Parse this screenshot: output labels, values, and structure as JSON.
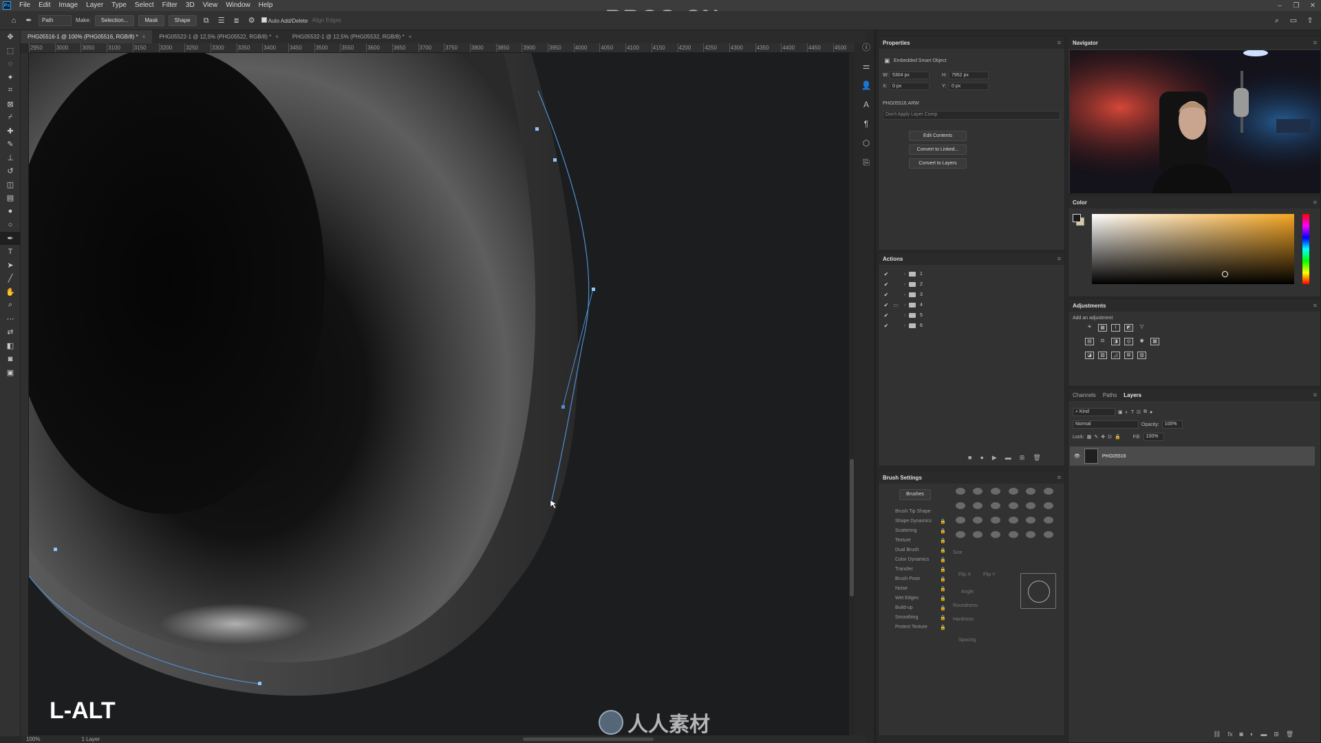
{
  "menu": [
    "File",
    "Edit",
    "Image",
    "Layer",
    "Type",
    "Select",
    "Filter",
    "3D",
    "View",
    "Window",
    "Help"
  ],
  "watermark_top": "RRCG.CN",
  "options": {
    "path_mode": "Path",
    "make_label": "Make:",
    "selection_btn": "Selection...",
    "mask_btn": "Mask",
    "shape_btn": "Shape",
    "auto_add": "Auto Add/Delete",
    "align_edges": "Align Edges"
  },
  "tabs": [
    "PHG05516-1 @ 100% (PHG05516, RGB/8) *",
    "PHG05522-1 @ 12,5% (PHG05522, RGB/8) *",
    "PHG05532-1 @ 12,5% (PHG05532, RGB/8) *"
  ],
  "ruler_ticks": [
    "2950",
    "3000",
    "3050",
    "3100",
    "3150",
    "3200",
    "3250",
    "3300",
    "3350",
    "3400",
    "3450",
    "3500",
    "3550",
    "3600",
    "3650",
    "3700",
    "3750",
    "3800",
    "3850",
    "3900",
    "3950",
    "4000",
    "4050",
    "4100",
    "4150",
    "4200",
    "4250",
    "4300",
    "4350",
    "4400",
    "4450",
    "4500"
  ],
  "key_overlay": "L-ALT",
  "watermark_bottom": "人人素材",
  "status": {
    "zoom": "100%",
    "layers": "1 Layer"
  },
  "properties": {
    "title": "Properties",
    "type": "Embedded Smart Object",
    "w_label": "W:",
    "w": "5304 px",
    "h_label": "H:",
    "h": "7952 px",
    "x_label": "X:",
    "x": "0 px",
    "y_label": "Y:",
    "y": "0 px",
    "file": "PHG05516.ARW",
    "layer_comp": "Don't Apply Layer Comp",
    "btn_edit": "Edit Contents",
    "btn_linked": "Convert to Linked...",
    "btn_layers": "Convert to Layers"
  },
  "navigator": {
    "title": "Navigator"
  },
  "color": {
    "title": "Color",
    "foreground": "#1a1a1a",
    "background": "#d8c8a0"
  },
  "actions": {
    "title": "Actions",
    "items": [
      "1",
      "2",
      "3",
      "4",
      "5",
      "6"
    ]
  },
  "adjustments": {
    "title": "Adjustments",
    "subtitle": "Add an adjustment"
  },
  "brush": {
    "title": "Brush Settings",
    "brushes_btn": "Brushes",
    "options": [
      "Brush Tip Shape",
      "Shape Dynamics",
      "Scattering",
      "Texture",
      "Dual Brush",
      "Color Dynamics",
      "Transfer",
      "Brush Pose",
      "Noise",
      "Wet Edges",
      "Build-up",
      "Smoothing",
      "Protect Texture"
    ],
    "size": "Size",
    "flip_x": "Flip X",
    "flip_y": "Flip Y",
    "angle": "Angle:",
    "roundness": "Roundness:",
    "hardness": "Hardness",
    "spacing": "Spacing"
  },
  "layers": {
    "tabs": [
      "Channels",
      "Paths",
      "Layers"
    ],
    "kind": "Kind",
    "blend": "Normal",
    "opacity_label": "Opacity:",
    "opacity": "100%",
    "lock_label": "Lock:",
    "fill_label": "Fill:",
    "fill": "100%",
    "layer_name": "PHG05516"
  }
}
